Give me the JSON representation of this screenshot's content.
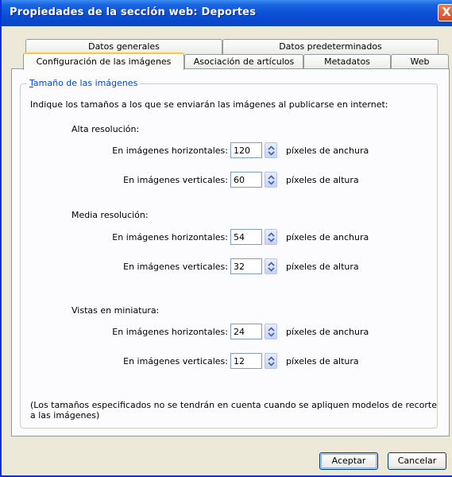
{
  "window": {
    "title": "Propiedades de la sección web: Deportes",
    "close_label": "X"
  },
  "tabs_back": [
    {
      "label": "Datos generales"
    },
    {
      "label": "Datos predeterminados"
    }
  ],
  "tabs_front": [
    {
      "label": "Configuración de las imágenes",
      "active": true
    },
    {
      "label": "Asociación de artículos"
    },
    {
      "label": "Metadatos"
    },
    {
      "label": "Web"
    }
  ],
  "group": {
    "legend_accel": "T",
    "legend_rest": "amaño de las imágenes",
    "intro": "Indique los tamaños a los que se enviarán las imágenes al publicarse en internet:",
    "horizontal_label": "En imágenes horizontales:",
    "vertical_label": "En imágenes verticales:",
    "width_unit": "píxeles de anchura",
    "height_unit": "píxeles de altura",
    "sections": [
      {
        "title": "Alta resolución:",
        "horizontal": "120",
        "vertical": "60"
      },
      {
        "title": "Media resolución:",
        "horizontal": "54",
        "vertical": "32"
      },
      {
        "title": "Vistas en miniatura:",
        "horizontal": "24",
        "vertical": "12"
      }
    ],
    "note_line1": "(Los tamaños especificados no se tendrán en cuenta cuando se apliquen modelos de recorte",
    "note_line2": "a las imágenes)"
  },
  "buttons": {
    "accept": "Aceptar",
    "cancel": "Cancelar"
  }
}
